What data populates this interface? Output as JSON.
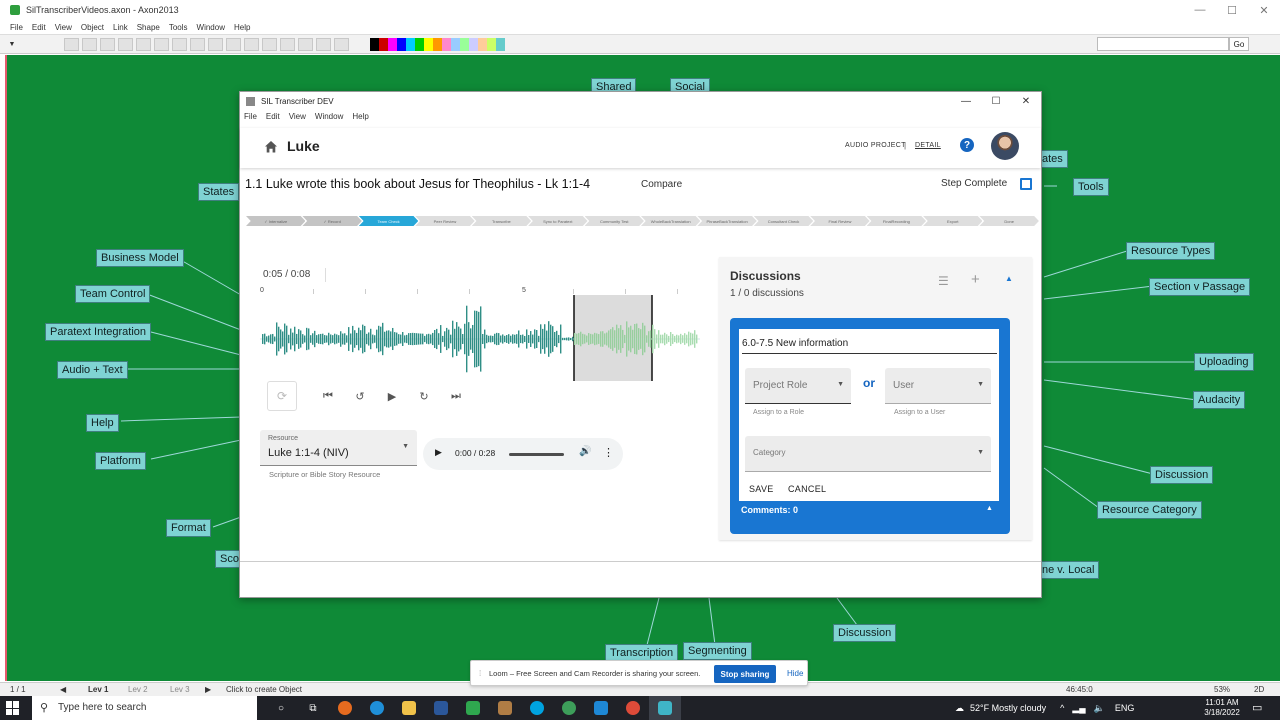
{
  "axon": {
    "title": "SilTranscriberVideos.axon - Axon2013",
    "menu": [
      "File",
      "Edit",
      "View",
      "Object",
      "Link",
      "Shape",
      "Tools",
      "Window",
      "Help"
    ],
    "go_label": "Go",
    "status": {
      "page": "1 / 1",
      "levels": [
        "Lev 1",
        "Lev 2",
        "Lev 3"
      ],
      "hint": "Click to create Object",
      "coords": "46:45:0",
      "zoom": "53%",
      "mode": "2D"
    }
  },
  "nodes": {
    "shared": "Shared",
    "social": "Social",
    "states": "States",
    "states_partial": "ates",
    "tools": "Tools",
    "business_model": "Business Model",
    "team_control": "Team Control",
    "paratext_integration": "Paratext Integration",
    "audio_text": "Audio + Text",
    "help": "Help",
    "platform": "Platform",
    "format": "Format",
    "scope_partial": "Sco",
    "resource_types": "Resource Types",
    "section_v_passage": "Section v Passage",
    "uploading": "Uploading",
    "audacity": "Audacity",
    "discussion_right": "Discussion",
    "resource_category": "Resource Category",
    "online_local_partial": "ne v. Local",
    "discussion_bottom": "Discussion",
    "transcription": "Transcription",
    "segmenting": "Segmenting"
  },
  "transcriber": {
    "window_title": "SIL Transcriber DEV",
    "menu": [
      "File",
      "Edit",
      "View",
      "Window",
      "Help"
    ],
    "project_name": "Luke",
    "header_links": {
      "audio_project": "AUDIO PROJECT",
      "separator": "|",
      "detail": "DETAIL"
    },
    "help_label": "?",
    "passage_title": "1.1   Luke wrote this book about Jesus for Theophilus - Lk 1:1-4",
    "compare_label": "Compare",
    "step_complete_label": "Step Complete",
    "step_complete_checked": false,
    "workflow": [
      {
        "label": "✓ Internalize",
        "state": "done"
      },
      {
        "label": "✓ Record",
        "state": "done"
      },
      {
        "label": "Team Check",
        "state": "current"
      },
      {
        "label": "Peer Review",
        "state": "todo"
      },
      {
        "label": "Transcribe",
        "state": "todo"
      },
      {
        "label": "Sync to Paratext",
        "state": "todo"
      },
      {
        "label": "Community Test",
        "state": "todo"
      },
      {
        "label": "WholeBackTranslation",
        "state": "todo"
      },
      {
        "label": "PhraseBackTranslation",
        "state": "todo"
      },
      {
        "label": "Consultant Check",
        "state": "todo"
      },
      {
        "label": "Final Review",
        "state": "todo"
      },
      {
        "label": "FinalRecording",
        "state": "todo"
      },
      {
        "label": "Export",
        "state": "todo"
      },
      {
        "label": "Done",
        "state": "todo"
      }
    ],
    "player": {
      "timecode": "0:05 / 0:08",
      "ruler_labels": {
        "zero": "0",
        "five": "5"
      }
    },
    "resource": {
      "label": "Resource",
      "value": "Luke 1:1-4 (NIV)",
      "helper": "Scripture or Bible Story Resource"
    },
    "audio": {
      "time": "0:00 / 0:28"
    },
    "discussions": {
      "title": "Discussions",
      "count": "1 / 0 discussions",
      "input_value": "6.0-7.5 New information",
      "role_label": "Project Role",
      "role_helper": "Assign to a Role",
      "or_label": "or",
      "user_label": "User",
      "user_helper": "Assign to a User",
      "category_label": "Category",
      "save_label": "SAVE",
      "cancel_label": "CANCEL",
      "comments_label": "Comments: 0"
    }
  },
  "loom": {
    "message": "Loom – Free Screen and Cam Recorder is sharing your screen.",
    "stop_label": "Stop sharing",
    "hide_label": "Hide"
  },
  "taskbar": {
    "search_placeholder": "Type here to search",
    "weather": "52°F  Mostly cloudy",
    "language": "ENG",
    "time": "11:01 AM",
    "date": "3/18/2022"
  },
  "colors": {
    "canvas_green": "#0f8a37",
    "node_fill": "#7fd3d3",
    "accent_blue": "#1976d2",
    "workflow_current": "#27a7d8",
    "waveform": "#2f8e86"
  }
}
